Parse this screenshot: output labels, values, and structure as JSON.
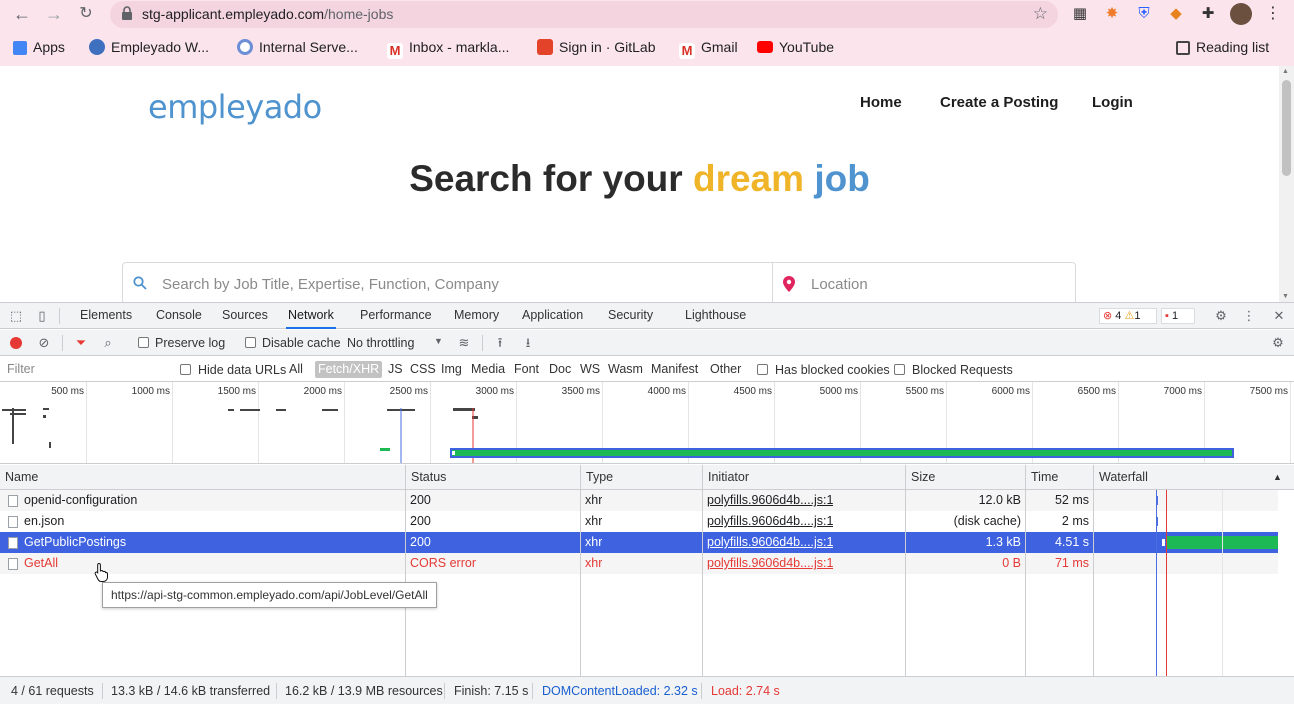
{
  "browser": {
    "url_host": "stg-applicant.empleyado.com",
    "url_path": "/home-jobs",
    "bookmarks": [
      {
        "label": "Apps",
        "icon": "apps-grid-icon"
      },
      {
        "label": "Empleyado W...",
        "icon": "empleyado-icon"
      },
      {
        "label": "Internal Serve...",
        "icon": "internal-server-icon"
      },
      {
        "label": "Inbox - markla...",
        "icon": "gmail-icon"
      },
      {
        "label": "Sign in · GitLab",
        "icon": "gitlab-icon"
      },
      {
        "label": "Gmail",
        "icon": "gmail-icon"
      },
      {
        "label": "YouTube",
        "icon": "youtube-icon"
      }
    ],
    "reading_list": "Reading list"
  },
  "page": {
    "logo": "empleyado",
    "nav": [
      "Home",
      "Create a Posting",
      "Login"
    ],
    "hero_prefix": "Search for your ",
    "hero_word1": "dream",
    "hero_space": " ",
    "hero_word2": "job",
    "search_placeholder": "Search by Job Title, Expertise, Function, Company",
    "location_placeholder": "Location"
  },
  "devtools": {
    "tabs": [
      "Elements",
      "Console",
      "Sources",
      "Network",
      "Performance",
      "Memory",
      "Application",
      "Security",
      "Lighthouse"
    ],
    "active_tab": "Network",
    "errors": "4",
    "warnings": "1",
    "issues": "1",
    "toolbar": {
      "preserve_log": "Preserve log",
      "disable_cache": "Disable cache",
      "throttling": "No throttling"
    },
    "filter": {
      "placeholder": "Filter",
      "hide_data_urls": "Hide data URLs",
      "types": [
        "All",
        "Fetch/XHR",
        "JS",
        "CSS",
        "Img",
        "Media",
        "Font",
        "Doc",
        "WS",
        "Wasm",
        "Manifest",
        "Other"
      ],
      "active_type": "Fetch/XHR",
      "has_blocked_cookies": "Has blocked cookies",
      "blocked_requests": "Blocked Requests"
    },
    "overview_ticks": [
      "500 ms",
      "1000 ms",
      "1500 ms",
      "2000 ms",
      "2500 ms",
      "3000 ms",
      "3500 ms",
      "4000 ms",
      "4500 ms",
      "5000 ms",
      "5500 ms",
      "6000 ms",
      "6500 ms",
      "7000 ms",
      "7500 ms"
    ],
    "columns": [
      "Name",
      "Status",
      "Type",
      "Initiator",
      "Size",
      "Time",
      "Waterfall"
    ],
    "requests": [
      {
        "name": "openid-configuration",
        "status": "200",
        "type": "xhr",
        "initiator": "polyfills.9606d4b....js:1",
        "size": "12.0 kB",
        "time": "52 ms"
      },
      {
        "name": "en.json",
        "status": "200",
        "type": "xhr",
        "initiator": "polyfills.9606d4b....js:1",
        "size": "(disk cache)",
        "time": "2 ms"
      },
      {
        "name": "GetPublicPostings",
        "status": "200",
        "type": "xhr",
        "initiator": "polyfills.9606d4b....js:1",
        "size": "1.3 kB",
        "time": "4.51 s"
      },
      {
        "name": "GetAll",
        "status": "CORS error",
        "type": "xhr",
        "initiator": "polyfills.9606d4b....js:1",
        "size": "0 B",
        "time": "71 ms"
      }
    ],
    "tooltip": "https://api-stg-common.empleyado.com/api/JobLevel/GetAll",
    "status_bar": {
      "requests": "4 / 61 requests",
      "transferred": "13.3 kB / 14.6 kB transferred",
      "resources": "16.2 kB / 13.9 MB resources",
      "finish": "Finish: 7.15 s",
      "dcl": "DOMContentLoaded: 2.32 s",
      "load": "Load: 2.74 s"
    },
    "colors": {
      "dcl": "#1a5fd0",
      "load": "#e53935",
      "selected_row": "#3e62e0",
      "waterfall_bar": "#1db954"
    }
  }
}
